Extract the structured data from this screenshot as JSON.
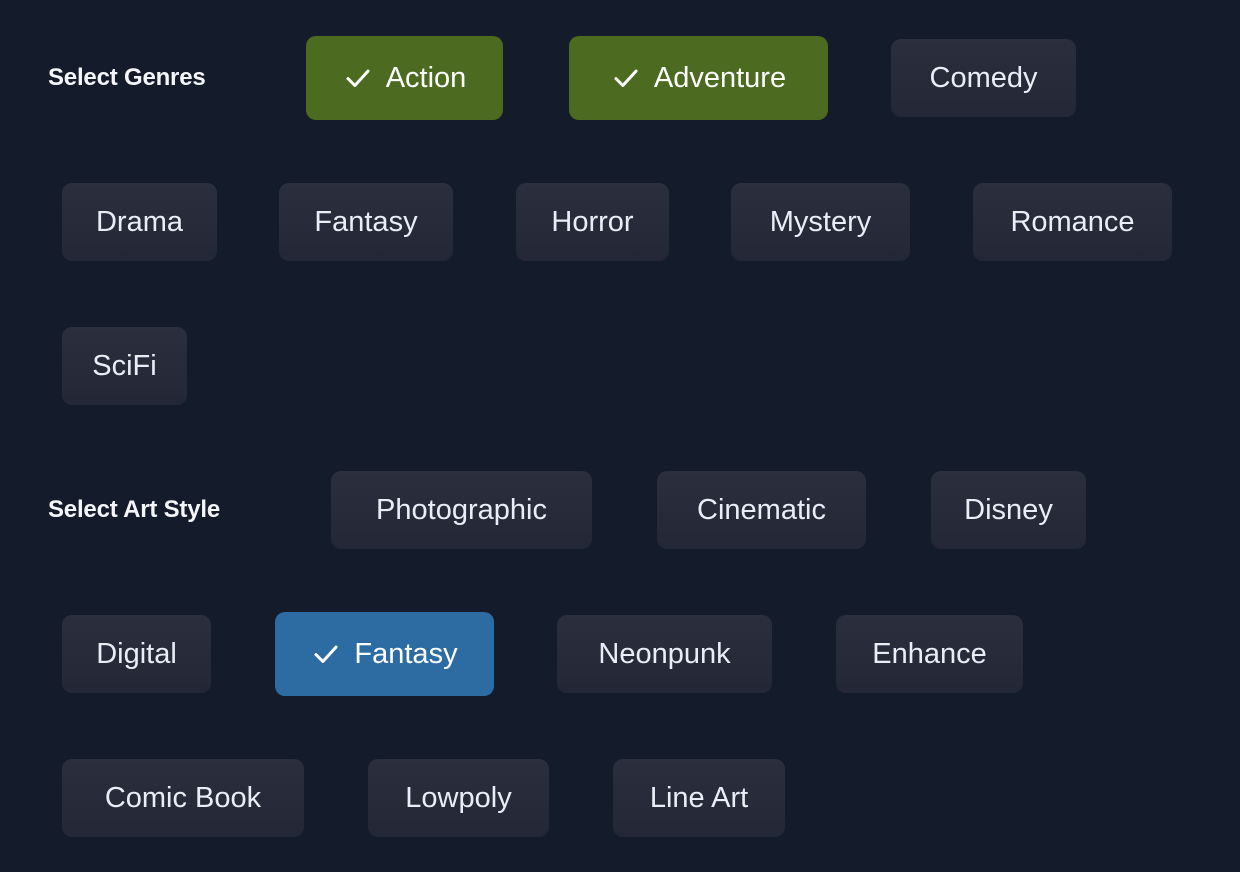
{
  "theme": {
    "background": "#141b2b",
    "chip_bg": "#272b38",
    "chip_text": "#e9edf5",
    "genre_selected_bg": "#4c6b20",
    "style_selected_bg": "#2d6ba3",
    "selected_text": "#ffffff",
    "label_text": "#f4f6fa"
  },
  "genres": {
    "label": "Select Genres",
    "options": [
      {
        "label": "Action",
        "selected": true
      },
      {
        "label": "Adventure",
        "selected": true
      },
      {
        "label": "Comedy",
        "selected": false
      },
      {
        "label": "Drama",
        "selected": false
      },
      {
        "label": "Fantasy",
        "selected": false
      },
      {
        "label": "Horror",
        "selected": false
      },
      {
        "label": "Mystery",
        "selected": false
      },
      {
        "label": "Romance",
        "selected": false
      },
      {
        "label": "SciFi",
        "selected": false
      }
    ],
    "selected": [
      "Action",
      "Adventure"
    ]
  },
  "art_style": {
    "label": "Select Art Style",
    "options": [
      {
        "label": "Photographic",
        "selected": false
      },
      {
        "label": "Cinematic",
        "selected": false
      },
      {
        "label": "Disney",
        "selected": false
      },
      {
        "label": "Digital",
        "selected": false
      },
      {
        "label": "Fantasy",
        "selected": true
      },
      {
        "label": "Neonpunk",
        "selected": false
      },
      {
        "label": "Enhance",
        "selected": false
      },
      {
        "label": "Comic Book",
        "selected": false
      },
      {
        "label": "Lowpoly",
        "selected": false
      },
      {
        "label": "Line Art",
        "selected": false
      }
    ],
    "selected": [
      "Fantasy"
    ]
  },
  "icons": {
    "check": "check-icon"
  }
}
